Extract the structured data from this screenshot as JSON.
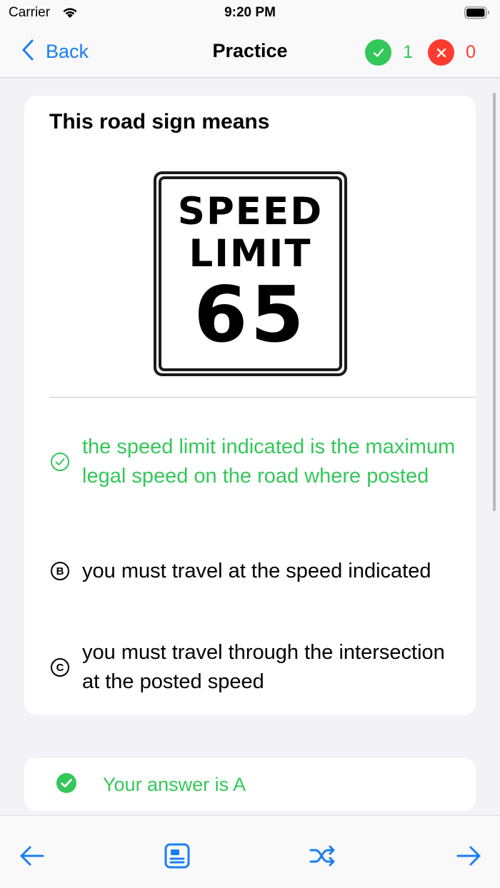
{
  "status_bar": {
    "carrier": "Carrier",
    "time": "9:20 PM"
  },
  "nav": {
    "back_label": "Back",
    "title": "Practice",
    "correct_count": "1",
    "wrong_count": "0"
  },
  "question": {
    "prompt": "This road sign means",
    "sign": {
      "line1": "SPEED",
      "line2": "LIMIT",
      "number": "65"
    },
    "answers": [
      {
        "letter": "A",
        "text": "the speed limit indicated is the maximum legal speed on the road where posted",
        "state": "correct"
      },
      {
        "letter": "B",
        "text": "you must travel at the speed indicated",
        "state": "normal"
      },
      {
        "letter": "C",
        "text": "you must travel through the intersection at the posted speed",
        "state": "normal"
      }
    ]
  },
  "result": {
    "text": "Your answer is A"
  },
  "toolbar": {
    "icons": [
      "arrow-left-icon",
      "card-icon",
      "shuffle-icon",
      "arrow-right-icon"
    ]
  },
  "colors": {
    "accent": "#1a7ef4",
    "correct": "#34c759",
    "wrong": "#ff3b30"
  }
}
